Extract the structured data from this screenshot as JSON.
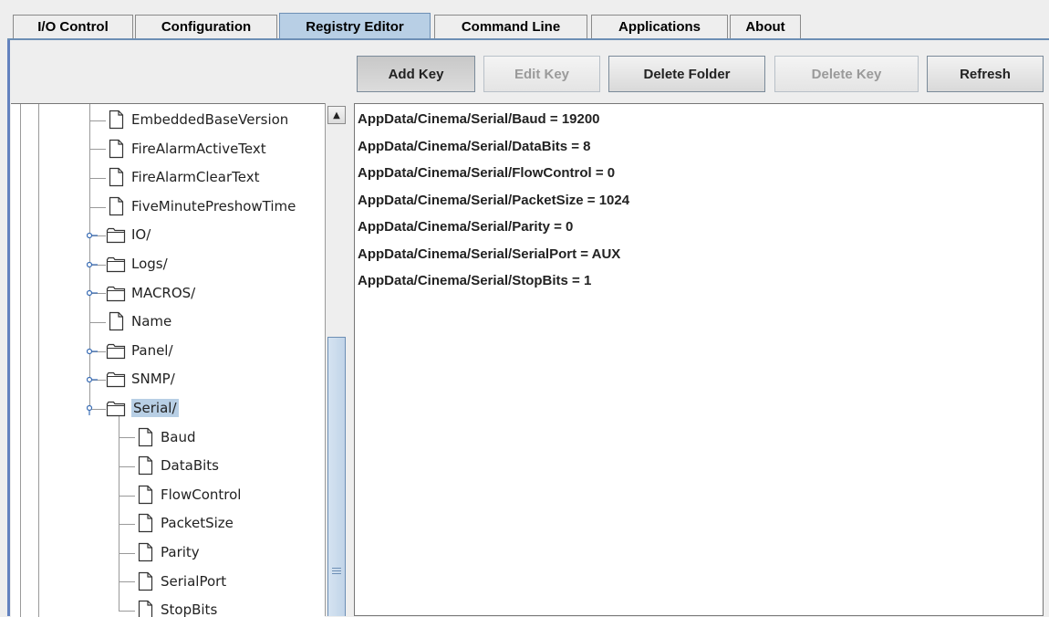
{
  "tabs": [
    {
      "label": "I/O Control",
      "active": false
    },
    {
      "label": "Configuration",
      "active": false
    },
    {
      "label": "Registry Editor",
      "active": true
    },
    {
      "label": "Command Line",
      "active": false
    },
    {
      "label": "Applications",
      "active": false
    },
    {
      "label": "About",
      "active": false
    }
  ],
  "toolbar": {
    "add_key": "Add Key",
    "edit_key": "Edit Key",
    "delete_folder": "Delete Folder",
    "delete_key": "Delete Key",
    "refresh": "Refresh"
  },
  "tree": {
    "nodes": [
      {
        "label": "EmbeddedBaseVersion",
        "type": "file"
      },
      {
        "label": "FireAlarmActiveText",
        "type": "file"
      },
      {
        "label": "FireAlarmClearText",
        "type": "file"
      },
      {
        "label": "FiveMinutePreshowTime",
        "type": "file"
      },
      {
        "label": "IO/",
        "type": "folder",
        "expanded": false
      },
      {
        "label": "Logs/",
        "type": "folder",
        "expanded": false
      },
      {
        "label": "MACROS/",
        "type": "folder",
        "expanded": false
      },
      {
        "label": "Name",
        "type": "file"
      },
      {
        "label": "Panel/",
        "type": "folder",
        "expanded": false
      },
      {
        "label": "SNMP/",
        "type": "folder",
        "expanded": false
      },
      {
        "label": "Serial/",
        "type": "folder",
        "expanded": true,
        "selected": true
      },
      {
        "label": "Baud",
        "type": "file",
        "child": true
      },
      {
        "label": "DataBits",
        "type": "file",
        "child": true
      },
      {
        "label": "FlowControl",
        "type": "file",
        "child": true
      },
      {
        "label": "PacketSize",
        "type": "file",
        "child": true
      },
      {
        "label": "Parity",
        "type": "file",
        "child": true
      },
      {
        "label": "SerialPort",
        "type": "file",
        "child": true
      },
      {
        "label": "StopBits",
        "type": "file",
        "child": true
      }
    ]
  },
  "content": {
    "entries": [
      "AppData/Cinema/Serial/Baud = 19200",
      "AppData/Cinema/Serial/DataBits = 8",
      "AppData/Cinema/Serial/FlowControl = 0",
      "AppData/Cinema/Serial/PacketSize = 1024",
      "AppData/Cinema/Serial/Parity = 0",
      "AppData/Cinema/Serial/SerialPort = AUX",
      "AppData/Cinema/Serial/StopBits = 1"
    ]
  },
  "colors": {
    "active_tab": "#b8cfe5",
    "frame_border": "#6382bf",
    "selection": "#b8cfe5"
  }
}
